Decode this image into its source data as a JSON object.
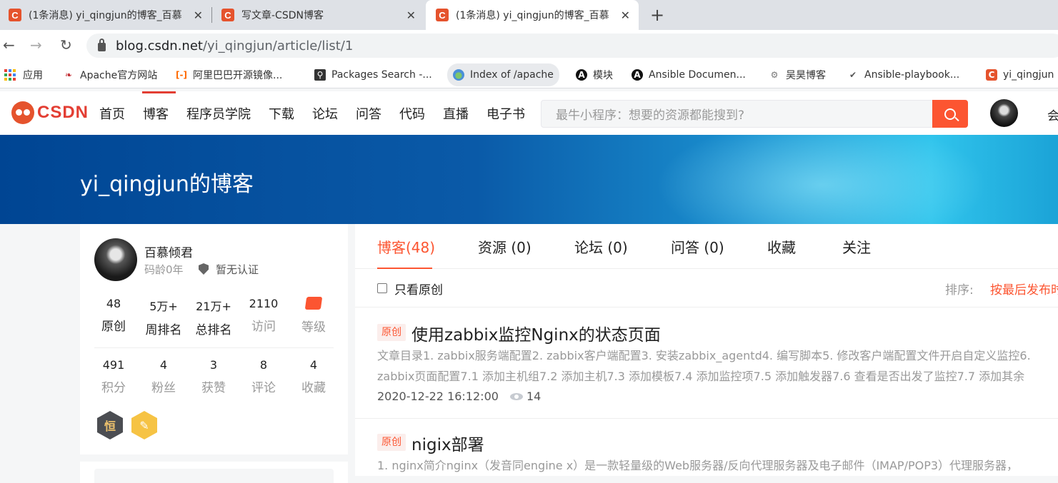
{
  "browser": {
    "tabs": [
      {
        "favicon": "C",
        "title": "(1条消息) yi_qingjun的博客_百慕",
        "active": false
      },
      {
        "favicon": "C",
        "title": "写文章-CSDN博客",
        "active": false
      },
      {
        "favicon": "C",
        "title": "(1条消息) yi_qingjun的博客_百慕",
        "active": true
      }
    ],
    "new_tab": "+",
    "close": "✕",
    "url_host": "blog.csdn.net",
    "url_path": "/yi_qingjun/article/list/1",
    "bookmarks": [
      {
        "label": "应用",
        "icon": "apps-grid-icon"
      },
      {
        "label": "Apache官方网站",
        "icon": "apache-feather-icon"
      },
      {
        "label": "阿里巴巴开源镜像...",
        "icon": "aliyun-icon"
      },
      {
        "label": "Packages Search -...",
        "icon": "packages-search-icon"
      },
      {
        "label": "Index of /apache",
        "icon": "globe-icon"
      },
      {
        "label": "模块",
        "icon": "ansible-icon"
      },
      {
        "label": "Ansible Documen...",
        "icon": "ansible-icon"
      },
      {
        "label": "吴昊博客",
        "icon": "gear-icon"
      },
      {
        "label": "Ansible-playbook...",
        "icon": "playbook-icon"
      },
      {
        "label": "yi_qingjun",
        "icon": "csdn-icon"
      }
    ]
  },
  "header": {
    "logo_text": "CSDN",
    "nav": [
      "首页",
      "博客",
      "程序员学院",
      "下载",
      "论坛",
      "问答",
      "代码",
      "直播",
      "电子书"
    ],
    "search_placeholder": "最牛小程序：想要的资源都能搜到?",
    "more": "会",
    "accent": "#fc5531"
  },
  "banner": {
    "title": "yi_qingjun的博客"
  },
  "profile": {
    "name": "百慕倾君",
    "code_age": "码龄0年",
    "certification": "暂无认证",
    "stats_row1": [
      {
        "value": "48",
        "label": "原创"
      },
      {
        "value": "5万+",
        "label": "周排名"
      },
      {
        "value": "21万+",
        "label": "总排名"
      },
      {
        "value": "2110",
        "label": "访问"
      },
      {
        "value": "",
        "label": "等级"
      }
    ],
    "stats_row2": [
      {
        "value": "491",
        "label": "积分"
      },
      {
        "value": "4",
        "label": "粉丝"
      },
      {
        "value": "3",
        "label": "获赞"
      },
      {
        "value": "8",
        "label": "评论"
      },
      {
        "value": "4",
        "label": "收藏"
      }
    ],
    "badge1_text": "恒",
    "badge2_text": "✎"
  },
  "content": {
    "tabs": [
      "博客(48)",
      "资源 (0)",
      "论坛 (0)",
      "问答 (0)",
      "收藏",
      "关注"
    ],
    "only_original": "只看原创",
    "sort_label": "排序:",
    "sort_value": "按最后发布时",
    "articles": [
      {
        "tag": "原创",
        "title": "使用zabbix监控Nginx的状态页面",
        "desc_line1": "文章目录1. zabbix服务端配置2. zabbix客户端配置3. 安装zabbix_agentd4. 编写脚本5. 修改客户端配置文件开启自定义监控6.",
        "desc_line2": "zabbix页面配置7.1 添加主机组7.2 添加主机7.3 添加模板7.4 添加监控项7.5 添加触发器7.6 查看是否出发了监控7.7 添加其余",
        "date": "2020-12-22 16:12:00",
        "views": "14"
      },
      {
        "tag": "原创",
        "title": "nigix部署",
        "desc_line1": "1. nginx简介nginx（发音同engine x）是一款轻量级的Web服务器/反向代理服务器及电子邮件（IMAP/POP3）代理服务器，"
      }
    ]
  }
}
